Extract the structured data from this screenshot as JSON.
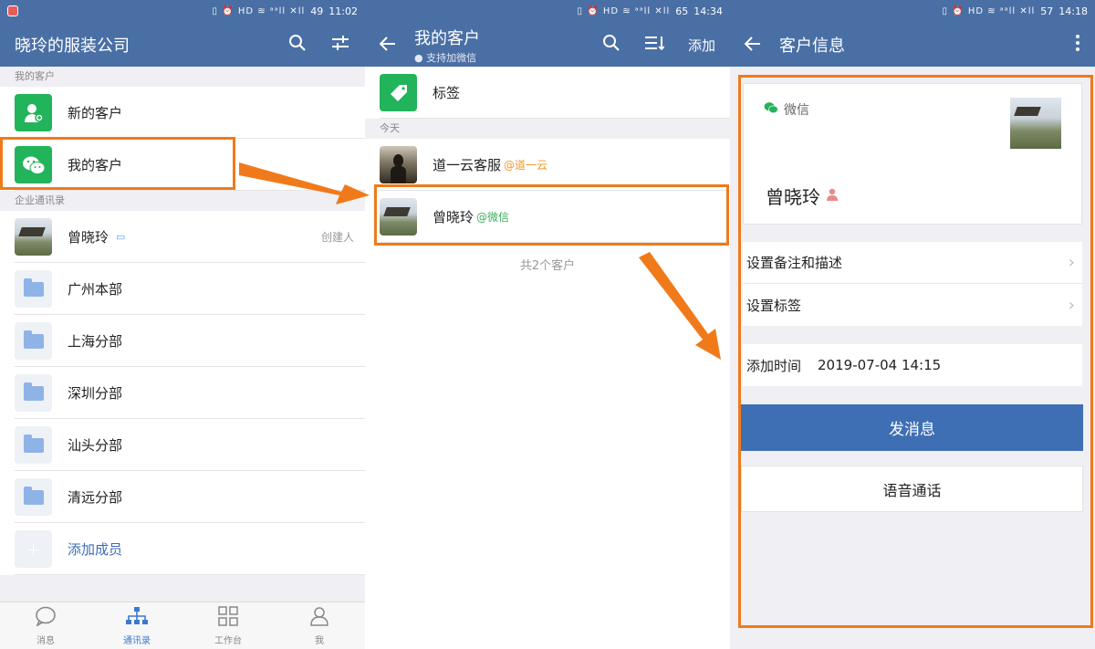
{
  "colors": {
    "brand_blue": "#4a6fa5",
    "accent_orange": "#f07a1a",
    "green": "#22b45a",
    "button_blue": "#3e6fb4"
  },
  "panel1": {
    "status": {
      "battery": "49",
      "time": "11:02"
    },
    "title": "晓玲的服装公司",
    "section_my_customers": "我的客户",
    "new_customers": "新的客户",
    "my_customers": "我的客户",
    "section_directory": "企业通讯录",
    "member": {
      "name": "曾晓玲",
      "note": "创建人"
    },
    "departments": [
      "广州本部",
      "上海分部",
      "深圳分部",
      "汕头分部",
      "清远分部"
    ],
    "add_member": "添加成员",
    "tabs": [
      {
        "label": "消息",
        "icon": "chat-bubble-icon"
      },
      {
        "label": "通讯录",
        "icon": "org-chart-icon"
      },
      {
        "label": "工作台",
        "icon": "grid-icon"
      },
      {
        "label": "我",
        "icon": "person-icon"
      }
    ]
  },
  "panel2": {
    "status": {
      "battery": "65",
      "time": "14:34"
    },
    "title": "我的客户",
    "subtitle": "支持加微信",
    "add_label": "添加",
    "tag_label": "标签",
    "section_today": "今天",
    "customers": [
      {
        "name": "道一云客服",
        "source": "@道一云"
      },
      {
        "name": "曾晓玲",
        "source": "@微信"
      }
    ],
    "count_note": "共2个客户"
  },
  "panel3": {
    "status": {
      "battery": "57",
      "time": "14:18"
    },
    "title": "客户信息",
    "card": {
      "source": "微信",
      "name": "曾晓玲"
    },
    "set_remark": "设置备注和描述",
    "set_tags": "设置标签",
    "add_time_label": "添加时间",
    "add_time_value": "2019-07-04 14:15",
    "send_message": "发消息",
    "voice_call": "语音通话"
  }
}
